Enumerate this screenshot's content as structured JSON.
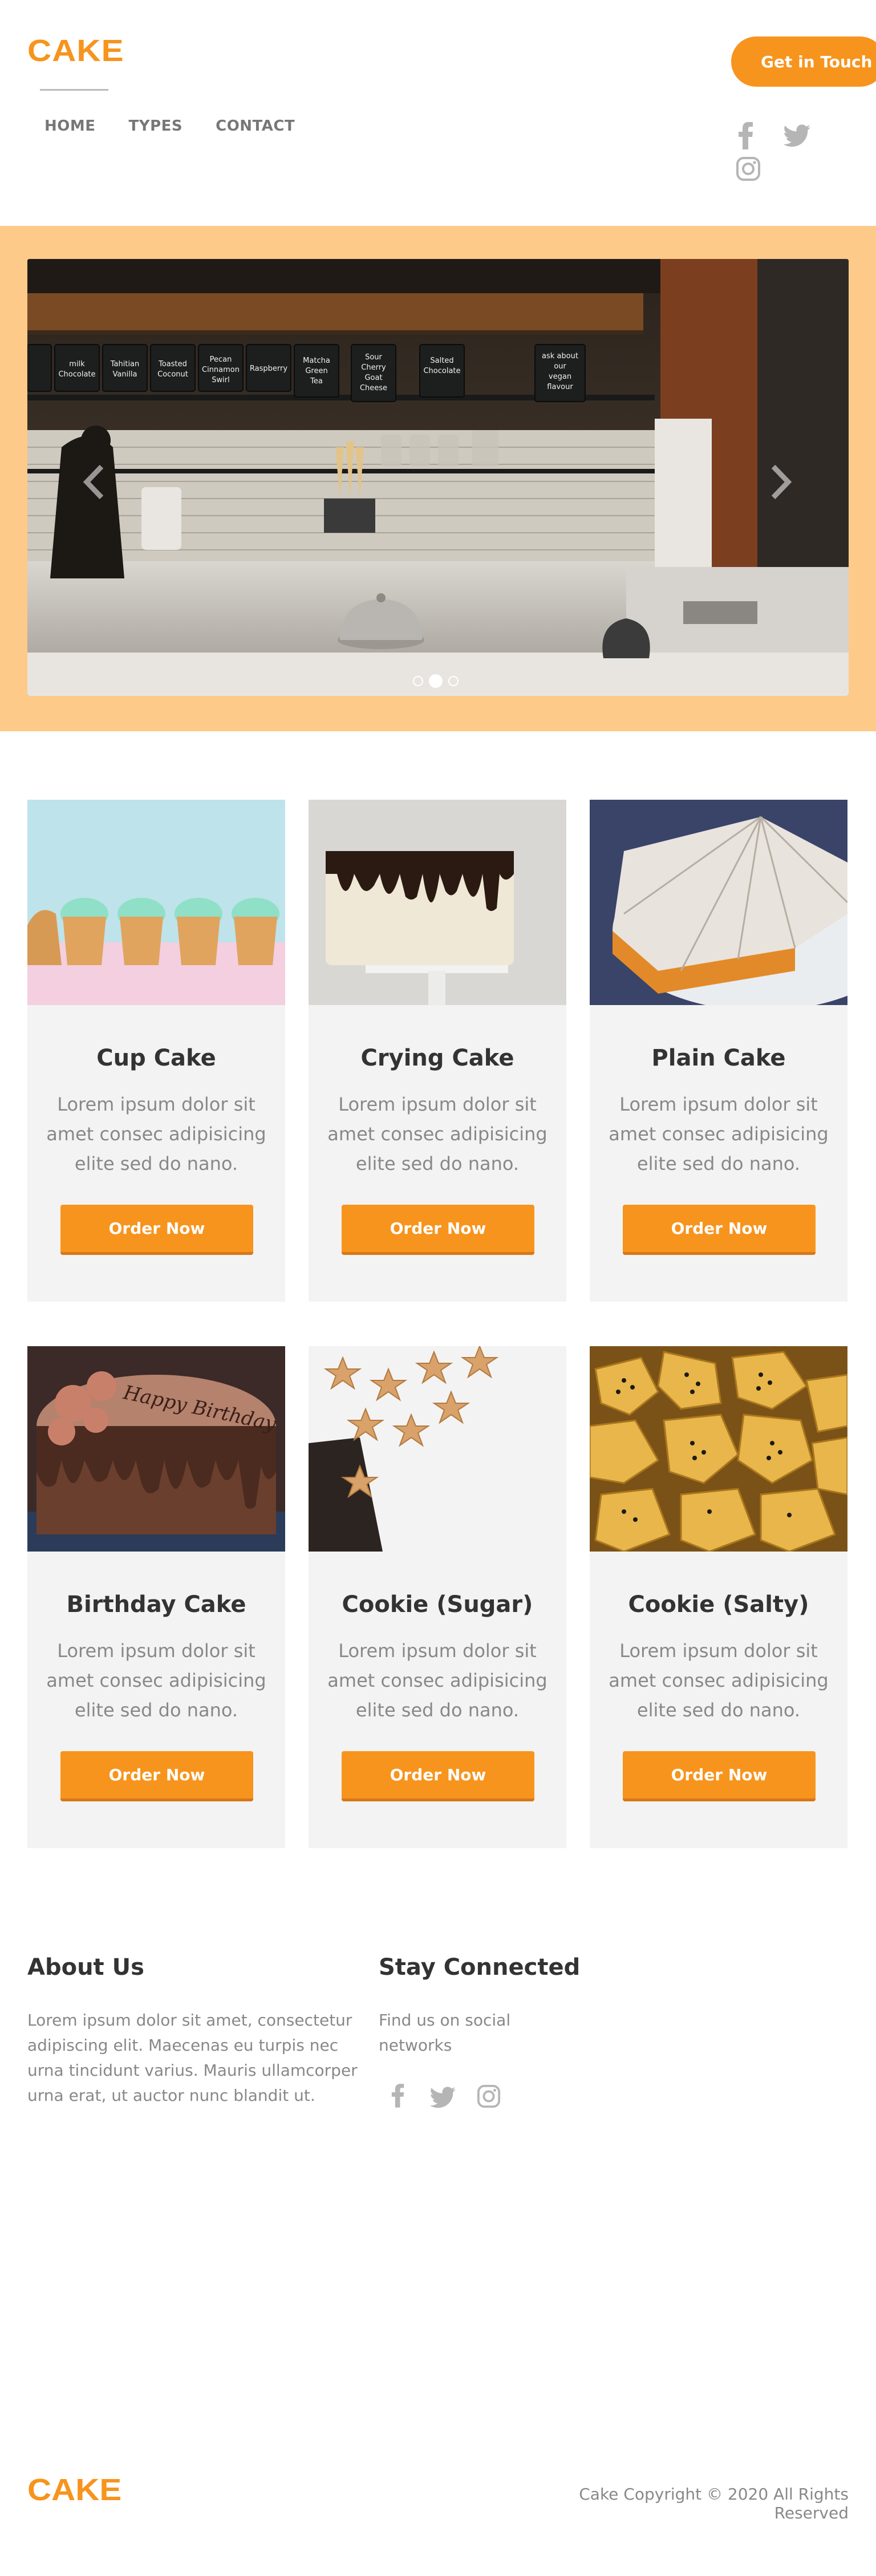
{
  "header": {
    "logo": "CAKE",
    "nav": [
      "HOME",
      "TYPES",
      "CONTACT"
    ],
    "cta_label": "Get in Touch",
    "social_icons": [
      "facebook-icon",
      "twitter-icon",
      "instagram-icon"
    ]
  },
  "hero": {
    "slide_count": 3,
    "active_slide": 2,
    "chalkboard_menu": [
      "milk Chocolate",
      "Tahitian Vanilla",
      "Toasted Coconut",
      "Pecan Cinnamon Swirl",
      "Raspberry",
      "Matcha Green Tea",
      "Sour Cherry Goat Cheese",
      "Salted Chocolate",
      "ask about our vegan flavour"
    ]
  },
  "products": [
    {
      "title": "Cup Cake",
      "desc": "Lorem ipsum dolor sit amet consec adipisicing elite sed do nano.",
      "button": "Order Now"
    },
    {
      "title": "Crying Cake",
      "desc": "Lorem ipsum dolor sit amet consec adipisicing elite sed do nano.",
      "button": "Order Now"
    },
    {
      "title": "Plain Cake",
      "desc": "Lorem ipsum dolor sit amet consec adipisicing elite sed do nano.",
      "button": "Order Now"
    },
    {
      "title": "Birthday Cake",
      "desc": "Lorem ipsum dolor sit amet consec adipisicing elite sed do nano.",
      "button": "Order Now",
      "cake_text": "Happy Birthday"
    },
    {
      "title": "Cookie (Sugar)",
      "desc": "Lorem ipsum dolor sit amet consec adipisicing elite sed do nano.",
      "button": "Order Now"
    },
    {
      "title": "Cookie (Salty)",
      "desc": "Lorem ipsum dolor sit amet consec adipisicing elite sed do nano.",
      "button": "Order Now"
    }
  ],
  "footer": {
    "about_title": "About Us",
    "about_text": "Lorem ipsum dolor sit amet, consectetur adipiscing elit. Maecenas eu turpis nec urna tincidunt varius. Mauris ullamcorper urna erat, ut auctor nunc blandit ut.",
    "stay_title": "Stay Connected",
    "stay_text": "Find us on social networks",
    "logo": "CAKE",
    "copyright": "Cake Copyright © 2020 All Rights Reserved"
  },
  "colors": {
    "accent": "#f7941d",
    "hero_bg": "#fdca8a",
    "card_bg": "#f3f3f3",
    "text_muted": "#888888",
    "text_dark": "#333333"
  }
}
